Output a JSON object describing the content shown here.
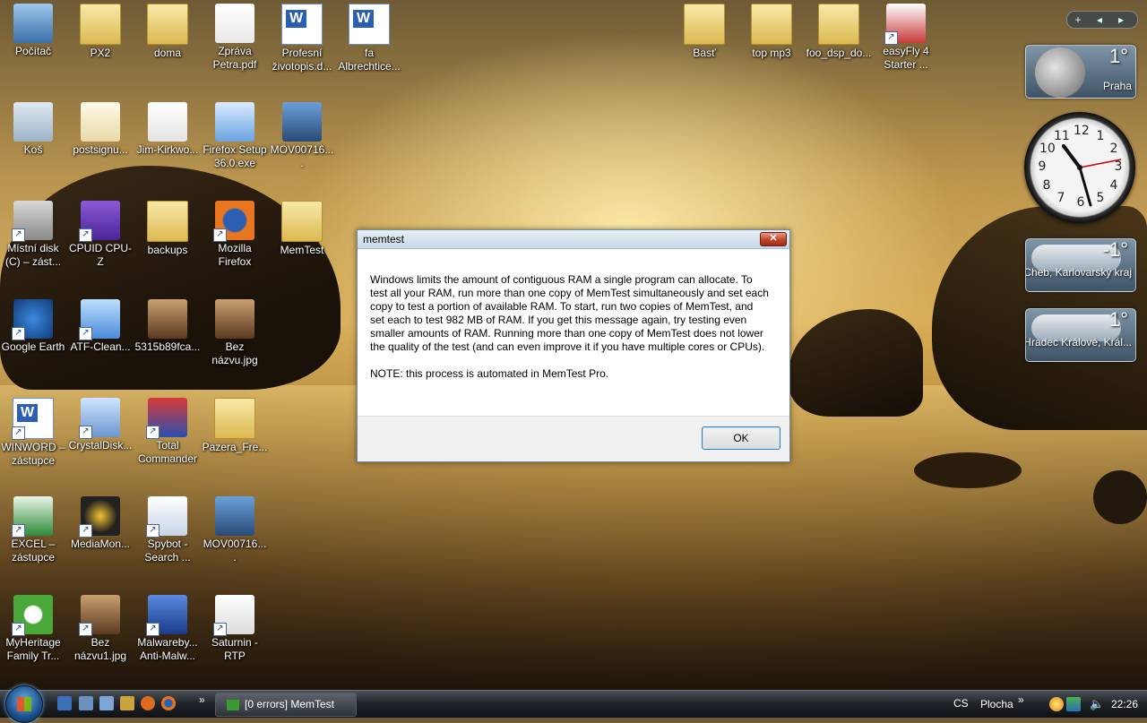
{
  "desktop_icons": [
    {
      "label": "Počítač"
    },
    {
      "label": "PX2"
    },
    {
      "label": "doma"
    },
    {
      "label": "Zpráva Petra.pdf"
    },
    {
      "label": "Profesní životopis.d..."
    },
    {
      "label": "fa Albrechtice..."
    },
    {
      "label": "Koš"
    },
    {
      "label": "postsignu..."
    },
    {
      "label": "Jim-Kirkwo..."
    },
    {
      "label": "Firefox Setup 36.0.exe"
    },
    {
      "label": "MOV00716...."
    },
    {
      "label": "Místní disk (C) – zást..."
    },
    {
      "label": "CPUID CPU-Z"
    },
    {
      "label": "backups"
    },
    {
      "label": "Mozilla Firefox"
    },
    {
      "label": "MemTest"
    },
    {
      "label": "Google Earth"
    },
    {
      "label": "ATF-Clean..."
    },
    {
      "label": "5315b89fca..."
    },
    {
      "label": "Bez názvu.jpg"
    },
    {
      "label": "WINWORD – zástupce"
    },
    {
      "label": "CrystalDisk..."
    },
    {
      "label": "Total Commander"
    },
    {
      "label": "Pazera_Fre..."
    },
    {
      "label": "EXCEL – zástupce"
    },
    {
      "label": "MediaMon..."
    },
    {
      "label": "Spybot - Search ..."
    },
    {
      "label": "MOV00716...."
    },
    {
      "label": "MyHeritage Family Tr..."
    },
    {
      "label": "Bez názvu1.jpg"
    },
    {
      "label": "Malwareby... Anti-Malw..."
    },
    {
      "label": "Saturnin - RTP"
    },
    {
      "label": "Basť"
    },
    {
      "label": "top mp3"
    },
    {
      "label": "foo_dsp_do..."
    },
    {
      "label": "easyFly 4 Starter ..."
    }
  ],
  "gadgets": {
    "weather": [
      {
        "temp": "1°",
        "city": "Praha"
      },
      {
        "temp": "-1°",
        "city": "Cheb, Karlovarský kraj"
      },
      {
        "temp": "1°",
        "city": "Hradec Králové, Král..."
      }
    ],
    "clock_numbers": [
      "12",
      "1",
      "2",
      "3",
      "4",
      "5",
      "6",
      "7",
      "8",
      "9",
      "10",
      "11"
    ],
    "controls": [
      "+",
      "◂",
      "▸"
    ]
  },
  "dialog": {
    "title": "memtest",
    "close_label": "✕",
    "message": "Windows limits the amount of contiguous RAM a single program can allocate. To test all your RAM, run more than one copy of MemTest simultaneously and set each copy to test a portion of available RAM. To start, run two copies of MemTest, and set each to test 982 MB of RAM. If you get this message again, try testing even smaller amounts of RAM. Running more than one copy of MemTest does not lower the quality of the test (and can even improve it if you have multiple cores or CPUs).",
    "note": "NOTE: this process is automated in MemTest Pro.",
    "ok_label": "OK"
  },
  "taskbar": {
    "task_button": "[0 errors] MemTest",
    "quicklaunch_more": "»",
    "language": "CS",
    "desktop_toolbar": "Plocha",
    "toolbar_more": "»",
    "time": "22:26"
  }
}
